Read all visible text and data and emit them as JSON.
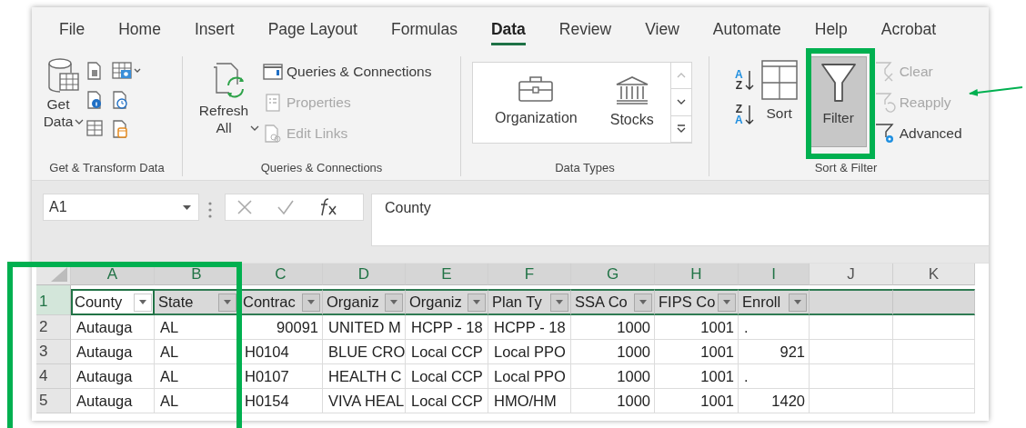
{
  "tabs": [
    {
      "label": "File",
      "selected": false
    },
    {
      "label": "Home",
      "selected": false
    },
    {
      "label": "Insert",
      "selected": false
    },
    {
      "label": "Page Layout",
      "selected": false
    },
    {
      "label": "Formulas",
      "selected": false
    },
    {
      "label": "Data",
      "selected": true
    },
    {
      "label": "Review",
      "selected": false
    },
    {
      "label": "View",
      "selected": false
    },
    {
      "label": "Automate",
      "selected": false
    },
    {
      "label": "Help",
      "selected": false
    },
    {
      "label": "Acrobat",
      "selected": false
    }
  ],
  "ribbon": {
    "get_transform": {
      "label": "Get & Transform Data",
      "get_data": "Get Data"
    },
    "queries": {
      "label": "Queries & Connections",
      "refresh": "Refresh All",
      "items": [
        {
          "label": "Queries & Connections",
          "disabled": false
        },
        {
          "label": "Properties",
          "disabled": true
        },
        {
          "label": "Edit Links",
          "disabled": true
        }
      ]
    },
    "data_types": {
      "label": "Data Types",
      "items": [
        "Organization",
        "Stocks"
      ]
    },
    "sort_filter": {
      "label": "Sort & Filter",
      "sort_ascending": [
        "A",
        "Z"
      ],
      "sort_descending": [
        "Z",
        "A"
      ],
      "sort": "Sort",
      "filter": {
        "label": "Filter",
        "selected": true
      },
      "items": [
        {
          "label": "Clear",
          "disabled": true
        },
        {
          "label": "Reapply",
          "disabled": true
        },
        {
          "label": "Advanced",
          "disabled": false
        }
      ]
    }
  },
  "formula_bar": {
    "name_box": "A1",
    "formula": "County"
  },
  "sheet": {
    "columns": [
      {
        "label": "A",
        "selected": true
      },
      {
        "label": "B",
        "selected": true
      },
      {
        "label": "C",
        "selected": true
      },
      {
        "label": "D",
        "selected": true
      },
      {
        "label": "E",
        "selected": true
      },
      {
        "label": "F",
        "selected": true
      },
      {
        "label": "G",
        "selected": true
      },
      {
        "label": "H",
        "selected": true
      },
      {
        "label": "I",
        "selected": true
      },
      {
        "label": "J",
        "selected": false
      },
      {
        "label": "K",
        "selected": false
      }
    ],
    "header_row": {
      "number": "1",
      "cells": [
        {
          "text": "County",
          "active": true
        },
        {
          "text": "State",
          "active": false
        },
        {
          "text": "Contrac",
          "active": false
        },
        {
          "text": "Organiz",
          "active": false
        },
        {
          "text": "Organiz",
          "active": false
        },
        {
          "text": "Plan Ty",
          "active": false
        },
        {
          "text": "SSA Co",
          "active": false
        },
        {
          "text": "FIPS Co",
          "active": false
        },
        {
          "text": "Enroll",
          "active": false
        }
      ]
    },
    "rows": [
      {
        "number": "2",
        "cells": [
          {
            "text": "Autauga",
            "kind": "text"
          },
          {
            "text": "AL",
            "kind": "text"
          },
          {
            "text": "90091",
            "kind": "number"
          },
          {
            "text": "UNITED M",
            "kind": "text"
          },
          {
            "text": "HCPP - 18",
            "kind": "text"
          },
          {
            "text": "HCPP - 18",
            "kind": "text"
          },
          {
            "text": "1000",
            "kind": "number"
          },
          {
            "text": "1001",
            "kind": "number"
          },
          {
            "text": ".",
            "kind": "text"
          }
        ]
      },
      {
        "number": "3",
        "cells": [
          {
            "text": "Autauga",
            "kind": "text"
          },
          {
            "text": "AL",
            "kind": "text"
          },
          {
            "text": "H0104",
            "kind": "text"
          },
          {
            "text": "BLUE CRO",
            "kind": "text"
          },
          {
            "text": "Local CCP",
            "kind": "text"
          },
          {
            "text": "Local PPO",
            "kind": "text"
          },
          {
            "text": "1000",
            "kind": "number"
          },
          {
            "text": "1001",
            "kind": "number"
          },
          {
            "text": "921",
            "kind": "number"
          }
        ]
      },
      {
        "number": "4",
        "cells": [
          {
            "text": "Autauga",
            "kind": "text"
          },
          {
            "text": "AL",
            "kind": "text"
          },
          {
            "text": "H0107",
            "kind": "text"
          },
          {
            "text": "HEALTH C",
            "kind": "text"
          },
          {
            "text": "Local CCP",
            "kind": "text"
          },
          {
            "text": "Local PPO",
            "kind": "text"
          },
          {
            "text": "1000",
            "kind": "number"
          },
          {
            "text": "1001",
            "kind": "number"
          },
          {
            "text": ".",
            "kind": "text"
          }
        ]
      },
      {
        "number": "5",
        "cells": [
          {
            "text": "Autauga",
            "kind": "text"
          },
          {
            "text": "AL",
            "kind": "text"
          },
          {
            "text": "H0154",
            "kind": "text"
          },
          {
            "text": "VIVA HEAL",
            "kind": "text"
          },
          {
            "text": "Local CCP",
            "kind": "text"
          },
          {
            "text": "HMO/HM",
            "kind": "text"
          },
          {
            "text": "1000",
            "kind": "number"
          },
          {
            "text": "1001",
            "kind": "number"
          },
          {
            "text": "1420",
            "kind": "number"
          }
        ]
      }
    ]
  }
}
